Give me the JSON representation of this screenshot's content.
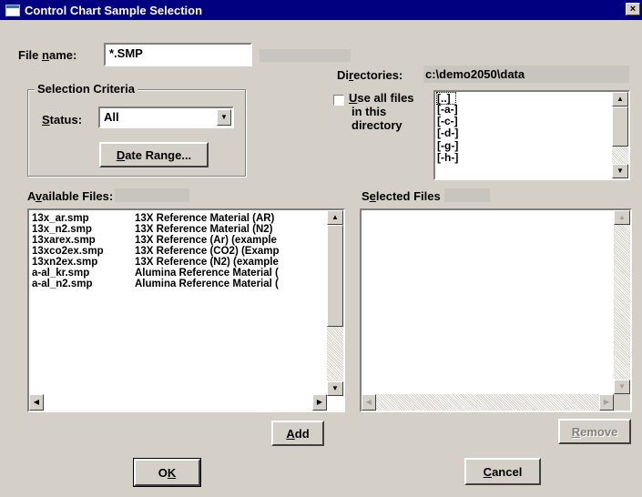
{
  "window": {
    "title": "Control Chart Sample Selection",
    "close_glyph": "×"
  },
  "file_name": {
    "label_pre": "File ",
    "label_ul": "n",
    "label_post": "ame:",
    "value": "*.SMP"
  },
  "directories": {
    "label_pre": "Di",
    "label_ul": "r",
    "label_post": "ectories:",
    "path": "c:\\demo2050\\data"
  },
  "selection_criteria": {
    "title": "Selection Criteria",
    "status_label_ul": "S",
    "status_label_post": "tatus:",
    "status_value": "All",
    "date_range_ul": "D",
    "date_range_post": "ate Range..."
  },
  "use_all_files": {
    "line1_ul": "U",
    "line1_post": "se all files",
    "line2": "in this",
    "line3": "directory",
    "checked": false
  },
  "directory_list": [
    "[..]",
    "[-a-]",
    "[-c-]",
    "[-d-]",
    "[-g-]",
    "[-h-]"
  ],
  "available_files": {
    "label_pre": "A",
    "label_ul": "v",
    "label_post": "ailable Files:",
    "rows": [
      {
        "file": "13x_ar.smp",
        "desc": "13X Reference Material (AR)"
      },
      {
        "file": "13x_n2.smp",
        "desc": "13X Reference Material (N2)"
      },
      {
        "file": "13xarex.smp",
        "desc": "13X Reference (Ar) (example"
      },
      {
        "file": "13xco2ex.smp",
        "desc": "13X Reference (CO2) (Examp"
      },
      {
        "file": "13xn2ex.smp",
        "desc": "13X Reference (N2) (example"
      },
      {
        "file": "a-al_kr.smp",
        "desc": "Alumina Reference Material ("
      },
      {
        "file": "a-al_n2.smp",
        "desc": "Alumina Reference Material ("
      }
    ]
  },
  "selected_files": {
    "label_pre": "S",
    "label_ul": "e",
    "label_post": "lected Files",
    "rows": []
  },
  "buttons": {
    "add_ul": "A",
    "add_post": "dd",
    "remove_ul": "R",
    "remove_post": "emove",
    "ok_pre": "O",
    "ok_ul": "K",
    "cancel_ul": "C",
    "cancel_post": "ancel"
  },
  "icons": {
    "scroll_up": "▲",
    "scroll_down": "▼",
    "scroll_left": "◀",
    "scroll_right": "▶",
    "dropdown": "▼"
  }
}
